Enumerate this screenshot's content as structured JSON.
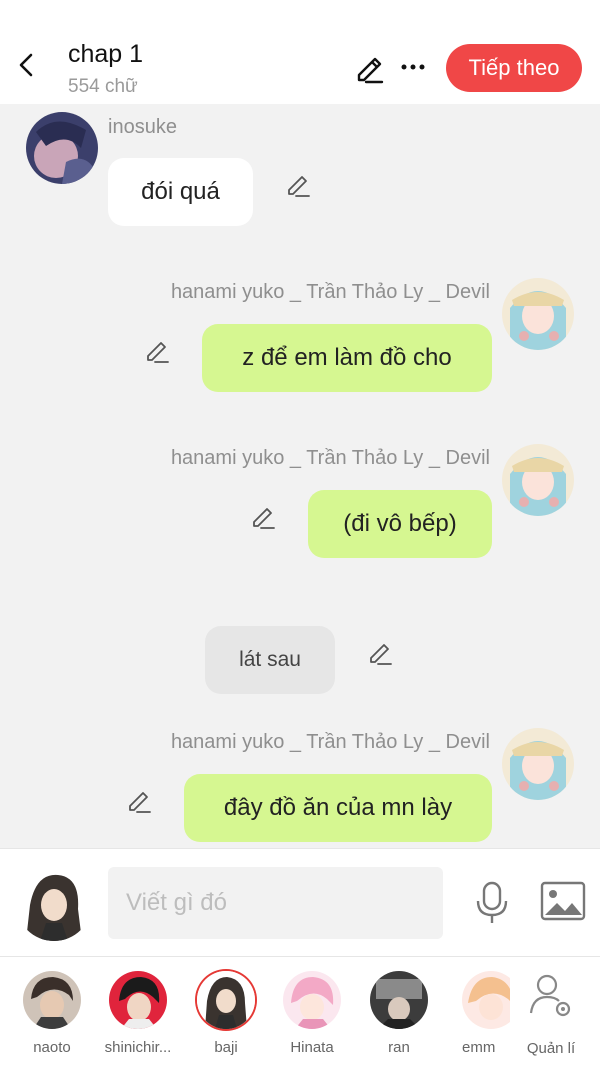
{
  "header": {
    "title": "chap 1",
    "word_count": "554 chữ",
    "next_label": "Tiếp theo",
    "next_color": "#f04747"
  },
  "messages": [
    {
      "kind": "left",
      "sender": "inosuke",
      "text": "đói quá"
    },
    {
      "kind": "right",
      "sender": "hanami yuko _ Trần Thảo Ly _ Devil",
      "text": "z để em làm đồ cho"
    },
    {
      "kind": "right",
      "sender": "hanami yuko _ Trần Thảo Ly _ Devil",
      "text": "(đi vô bếp)"
    },
    {
      "kind": "narration",
      "text": "lát sau"
    },
    {
      "kind": "right",
      "sender": "hanami yuko _ Trần Thảo Ly _ Devil",
      "text": "đây đồ ăn của mn lày"
    }
  ],
  "input": {
    "placeholder": "Viết gì đó"
  },
  "characters": [
    {
      "name": "naoto",
      "selected": false
    },
    {
      "name": "shinichir...",
      "selected": false
    },
    {
      "name": "baji",
      "selected": true
    },
    {
      "name": "Hinata",
      "selected": false
    },
    {
      "name": "ran",
      "selected": false
    },
    {
      "name": "emm",
      "selected": false
    }
  ],
  "manage_label": "Quản lí",
  "colors": {
    "my_bubble": "#d6f791",
    "other_bubble": "#ffffff",
    "narration_bubble": "#e6e6e6",
    "chat_bg": "#f2f2f2"
  }
}
